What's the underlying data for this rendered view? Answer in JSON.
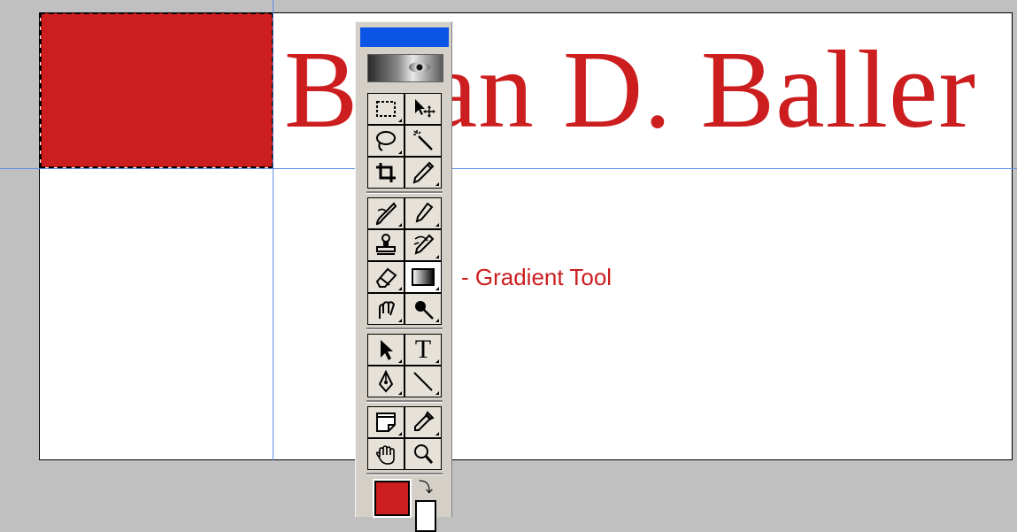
{
  "document": {
    "title_text": "Brian D. Baller",
    "callout_text": "- Gradient Tool"
  },
  "colors": {
    "foreground": "#cc1d1f",
    "background": "#ffffff",
    "guide": "#5f8ee6",
    "titlebar": "#0a54e6"
  },
  "toolbox": {
    "tools": [
      {
        "name": "rectangular-marquee",
        "icon": "marquee-icon"
      },
      {
        "name": "move",
        "icon": "move-icon"
      },
      {
        "name": "lasso",
        "icon": "lasso-icon"
      },
      {
        "name": "magic-wand",
        "icon": "magic-wand-icon"
      },
      {
        "name": "crop",
        "icon": "crop-icon"
      },
      {
        "name": "slice",
        "icon": "slice-icon"
      },
      {
        "name": "healing-brush",
        "icon": "healing-brush-icon"
      },
      {
        "name": "brush",
        "icon": "brush-icon"
      },
      {
        "name": "clone-stamp",
        "icon": "clone-stamp-icon"
      },
      {
        "name": "history-brush",
        "icon": "history-brush-icon"
      },
      {
        "name": "eraser",
        "icon": "eraser-icon"
      },
      {
        "name": "gradient",
        "icon": "gradient-icon",
        "active": true
      },
      {
        "name": "smudge",
        "icon": "smudge-icon"
      },
      {
        "name": "dodge",
        "icon": "dodge-icon"
      },
      {
        "name": "path-selection",
        "icon": "arrow-icon"
      },
      {
        "name": "type",
        "icon": "type-icon",
        "label": "T"
      },
      {
        "name": "pen",
        "icon": "pen-icon"
      },
      {
        "name": "line",
        "icon": "line-icon"
      },
      {
        "name": "notes",
        "icon": "notes-icon"
      },
      {
        "name": "eyedropper",
        "icon": "eyedropper-icon"
      },
      {
        "name": "hand",
        "icon": "hand-icon"
      },
      {
        "name": "zoom",
        "icon": "zoom-icon"
      }
    ]
  }
}
